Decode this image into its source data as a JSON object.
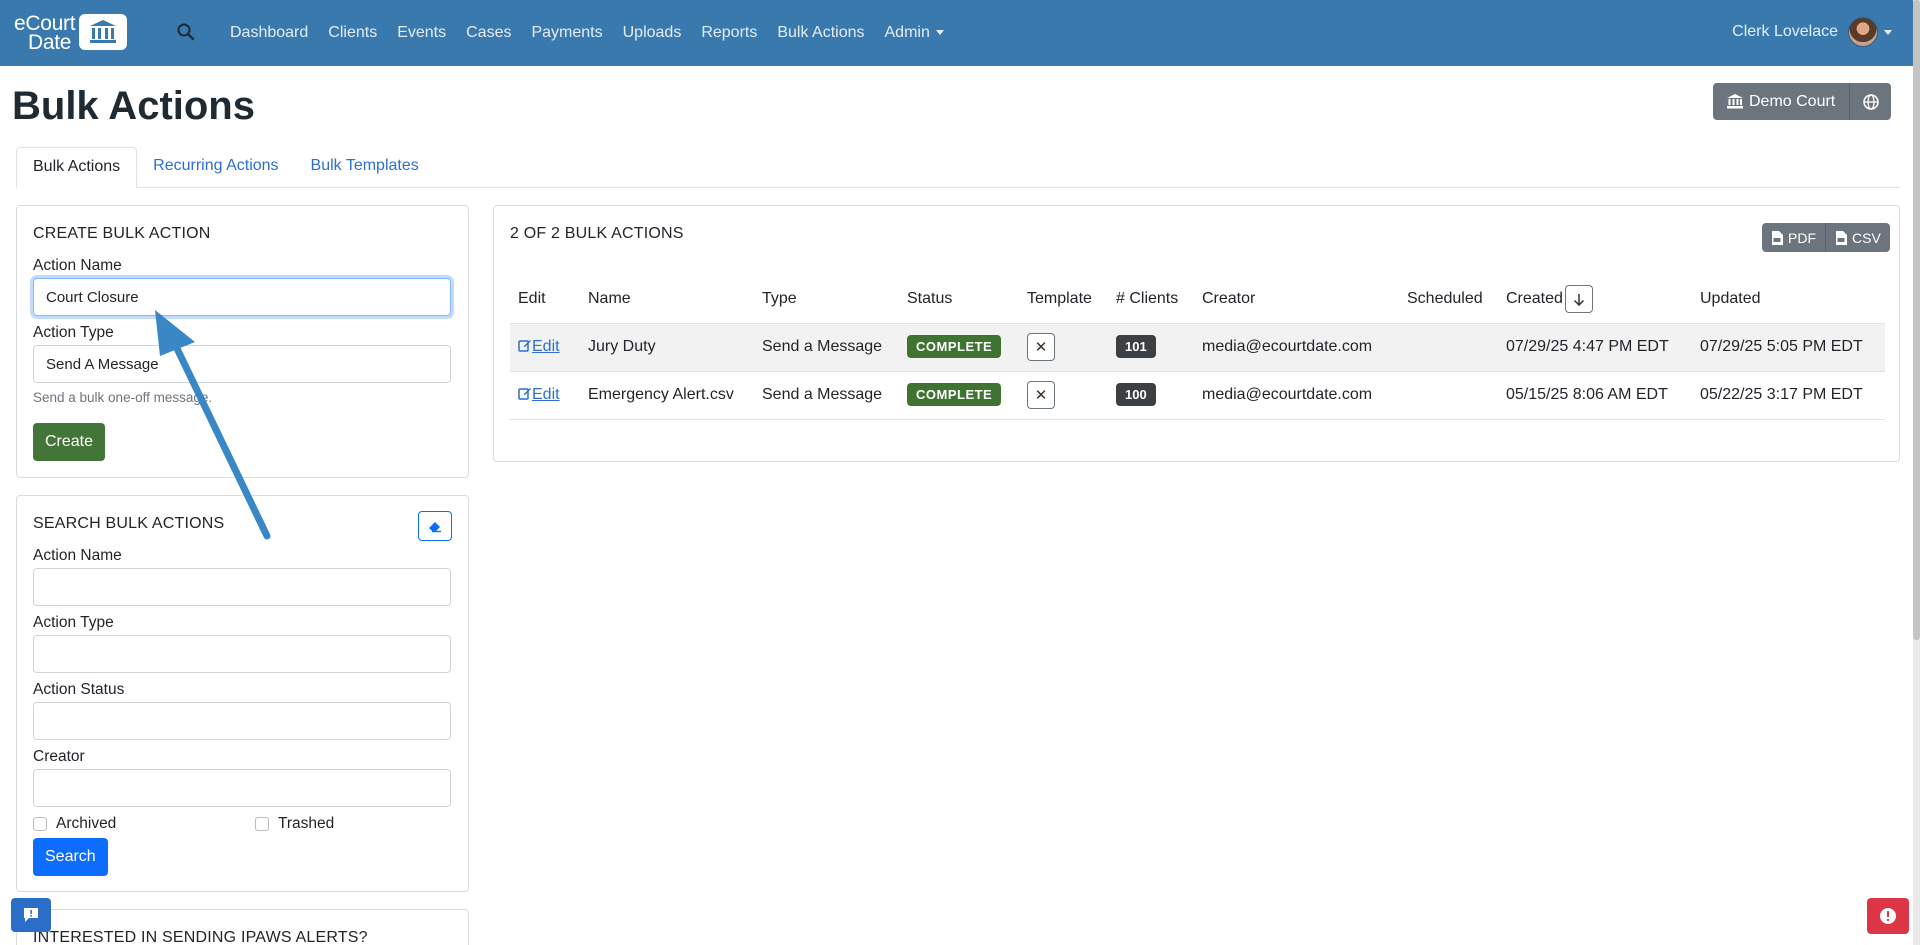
{
  "navbar": {
    "brand_line1": "eCourt",
    "brand_line2": "Date",
    "links": [
      "Dashboard",
      "Clients",
      "Events",
      "Cases",
      "Payments",
      "Uploads",
      "Reports",
      "Bulk Actions",
      "Admin"
    ],
    "user_name": "Clerk Lovelace",
    "bg_color": "#3a79ad"
  },
  "header": {
    "title": "Bulk Actions",
    "court_label": "Demo Court"
  },
  "tabs": [
    "Bulk Actions",
    "Recurring Actions",
    "Bulk Templates"
  ],
  "create": {
    "title": "CREATE BULK ACTION",
    "name_label": "Action Name",
    "name_value": "Court Closure",
    "type_label": "Action Type",
    "type_value": "Send A Message",
    "help_text": "Send a bulk one-off message.",
    "create_label": "Create"
  },
  "search": {
    "title": "SEARCH BULK ACTIONS",
    "name_label": "Action Name",
    "type_label": "Action Type",
    "status_label": "Action Status",
    "creator_label": "Creator",
    "archived_label": "Archived",
    "trashed_label": "Trashed",
    "search_label": "Search"
  },
  "ipaws": {
    "title": "INTERESTED IN SENDING IPAWS ALERTS?"
  },
  "results": {
    "count_label": "2 OF 2 BULK ACTIONS",
    "pdf_label": "PDF",
    "csv_label": "CSV",
    "columns": [
      "Edit",
      "Name",
      "Type",
      "Status",
      "Template",
      "# Clients",
      "Creator",
      "Scheduled",
      "Created",
      "Updated"
    ],
    "rows": [
      {
        "edit": "Edit",
        "name": "Jury Duty",
        "type": "Send a Message",
        "status": "COMPLETE",
        "clients": "101",
        "creator": "media@ecourtdate.com",
        "scheduled": "",
        "created": "07/29/25 4:47 PM EDT",
        "updated": "07/29/25 5:05 PM EDT"
      },
      {
        "edit": "Edit",
        "name": "Emergency Alert.csv",
        "type": "Send a Message",
        "status": "COMPLETE",
        "clients": "100",
        "creator": "media@ecourtdate.com",
        "scheduled": "",
        "created": "05/15/25 8:06 AM EDT",
        "updated": "05/22/25 3:17 PM EDT"
      }
    ]
  },
  "icons": {
    "search": "search-icon",
    "court": "bank-icon",
    "globe": "globe-icon",
    "eraser": "eraser-icon",
    "edit": "edit-icon",
    "pdf": "file-pdf-icon",
    "csv": "file-csv-icon",
    "sort": "arrow-down-icon",
    "chat": "chat-icon",
    "alert": "alert-icon"
  },
  "colors": {
    "accent": "#0d6efd",
    "success": "#437438",
    "danger": "#dc3545",
    "annotation_arrow": "#3a87c6"
  }
}
